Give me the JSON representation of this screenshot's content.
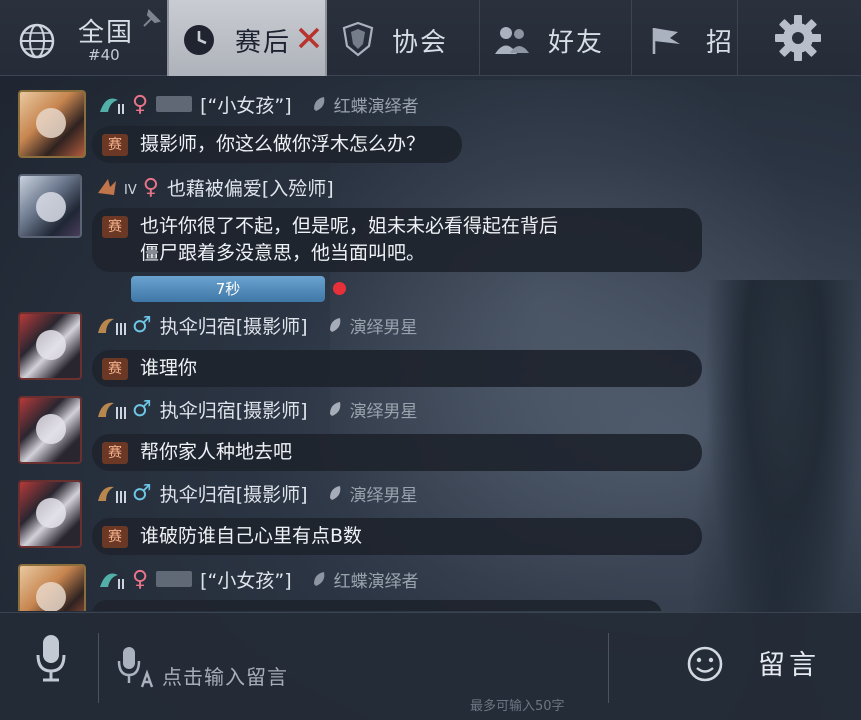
{
  "tabs": {
    "world": {
      "label": "全国",
      "rank": "#40"
    },
    "post_match": {
      "label": "赛后"
    },
    "association": {
      "label": "协会"
    },
    "friends": {
      "label": "好友"
    },
    "more": {
      "label": "招"
    }
  },
  "messages": [
    {
      "gender": "♀",
      "username": "[“小女孩”]",
      "title": "红蝶演绎者",
      "sai": "赛",
      "text": "摄影师，你这么做你浮木怎么办？"
    },
    {
      "gender": "♀",
      "username": "也藉被偏爱[入殓师]",
      "tier": "IV",
      "sai": "赛",
      "text_line1": "也许你很了不起，但是呢，姐未未必看得起在背后",
      "text_line2": "僵尸跟着多没意思，他当面叫吧。",
      "voice_label": "7秒"
    },
    {
      "gender": "♂",
      "username": "执伞归宿[摄影师]",
      "title": "演绎男星",
      "sai": "赛",
      "text": "谁理你"
    },
    {
      "gender": "♂",
      "username": "执伞归宿[摄影师]",
      "title": "演绎男星",
      "sai": "赛",
      "text": "帮你家人种地去吧"
    },
    {
      "gender": "♂",
      "username": "执伞归宿[摄影师]",
      "title": "演绎男星",
      "sai": "赛",
      "text": "谁破防谁自己心里有点B数"
    },
    {
      "gender": "♀",
      "username": "[“小女孩”]",
      "title": "红蝶演绎者"
    }
  ],
  "input": {
    "placeholder": "点击输入留言",
    "hint": "最多可输入50字",
    "send_label": "留言"
  },
  "colors": {
    "active_tab": "#c9ccd2",
    "female": "#e8748a",
    "male": "#6ec6e6",
    "voice_bar": "#4f88b8",
    "record_dot": "#e8303a",
    "sai_badge": "#6b3826"
  }
}
